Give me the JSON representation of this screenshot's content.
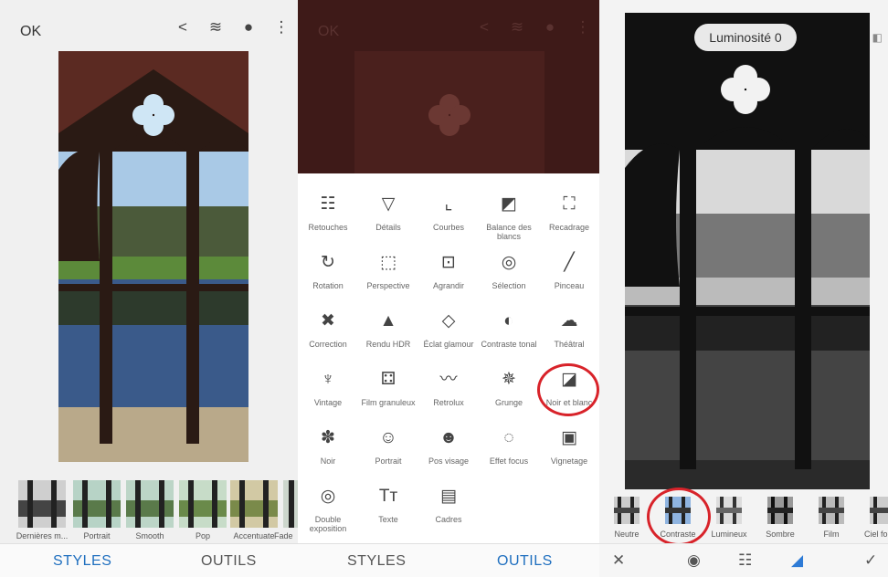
{
  "panel1": {
    "ok_label": "OK",
    "icons": [
      "share-icon",
      "layers-icon",
      "info-icon",
      "more-icon"
    ],
    "styles": [
      "Dernières m...",
      "Portrait",
      "Smooth",
      "Pop",
      "Accentuate",
      "Fade"
    ],
    "tabs": {
      "styles": "STYLES",
      "outils": "OUTILS"
    }
  },
  "panel2": {
    "ok_label": "OK",
    "tools": [
      {
        "label": "Retouches",
        "icon": "☷"
      },
      {
        "label": "Détails",
        "icon": "▽"
      },
      {
        "label": "Courbes",
        "icon": "⌞"
      },
      {
        "label": "Balance des blancs",
        "icon": "◩"
      },
      {
        "label": "Recadrage",
        "icon": "⛶"
      },
      {
        "label": "Rotation",
        "icon": "↻"
      },
      {
        "label": "Perspective",
        "icon": "⬚"
      },
      {
        "label": "Agrandir",
        "icon": "⊡"
      },
      {
        "label": "Sélection",
        "icon": "◎"
      },
      {
        "label": "Pinceau",
        "icon": "╱"
      },
      {
        "label": "Correction",
        "icon": "✖"
      },
      {
        "label": "Rendu HDR",
        "icon": "▲"
      },
      {
        "label": "Éclat glamour",
        "icon": "◇"
      },
      {
        "label": "Contraste tonal",
        "icon": "◐"
      },
      {
        "label": "Théâtral",
        "icon": "☁"
      },
      {
        "label": "Vintage",
        "icon": "♆"
      },
      {
        "label": "Film granuleux",
        "icon": "⚃"
      },
      {
        "label": "Retrolux",
        "icon": "〰"
      },
      {
        "label": "Grunge",
        "icon": "✵"
      },
      {
        "label": "Noir et blanc",
        "icon": "◪"
      },
      {
        "label": "Noir",
        "icon": "✽"
      },
      {
        "label": "Portrait",
        "icon": "☺"
      },
      {
        "label": "Pos visage",
        "icon": "☻"
      },
      {
        "label": "Effet focus",
        "icon": "◌"
      },
      {
        "label": "Vignetage",
        "icon": "▣"
      },
      {
        "label": "Double exposition",
        "icon": "◎"
      },
      {
        "label": "Texte",
        "icon": "Tт"
      },
      {
        "label": "Cadres",
        "icon": "▤"
      }
    ],
    "tabs": {
      "styles": "STYLES",
      "outils": "OUTILS"
    }
  },
  "panel3": {
    "pill": "Luminosité 0",
    "filters": [
      "Neutre",
      "Contraste",
      "Lumineux",
      "Sombre",
      "Film",
      "Ciel fo"
    ],
    "bottom_icons": [
      "close-icon",
      "style-icon",
      "adjust-icon",
      "filter-color-icon",
      "apply-icon"
    ]
  },
  "colors": {
    "accent": "#1f6fbf",
    "highlight_circle": "#d8232a"
  }
}
